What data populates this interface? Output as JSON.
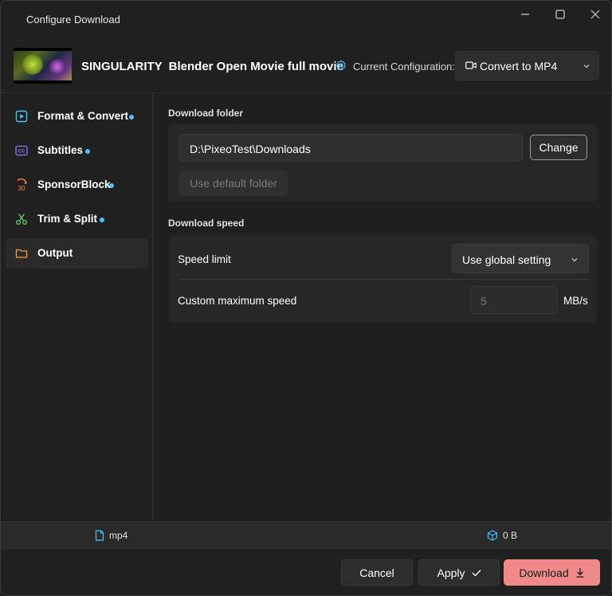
{
  "window": {
    "title": "Configure Download",
    "controls": [
      "minimize-icon",
      "maximize-icon",
      "close-icon"
    ]
  },
  "header": {
    "video_title_part1": "SINGULARITY",
    "video_title_part2": "Blender Open Movie full movie",
    "config_label": "Current Configuration:",
    "config_value": "Convert to MP4",
    "config_icon": "video-icon",
    "accent": "#4cc2ff"
  },
  "sidebar": {
    "items": [
      {
        "label": "Format & Convert",
        "icon": "format-icon",
        "has_dot": true,
        "icon_color": "#4cc2ff"
      },
      {
        "label": "Subtitles",
        "icon": "subtitles-icon",
        "has_dot": true,
        "icon_color": "#8a7bff"
      },
      {
        "label": "SponsorBlock",
        "icon": "sponsorblock-icon",
        "has_dot": true,
        "icon_color": "#ff8a4c"
      },
      {
        "label": "Trim & Split",
        "icon": "scissors-icon",
        "has_dot": true,
        "icon_color": "#6ad06a"
      },
      {
        "label": "Output",
        "icon": "folder-icon",
        "has_dot": false,
        "icon_color": "#ff9a3c",
        "active": true
      }
    ]
  },
  "main": {
    "download_folder": {
      "section_label": "Download folder",
      "path_value": "D:\\PixeoTest\\Downloads",
      "change_label": "Change",
      "default_label": "Use default folder"
    },
    "download_speed": {
      "section_label": "Download speed",
      "speed_limit_label": "Speed limit",
      "speed_limit_value": "Use global setting",
      "custom_label": "Custom maximum speed",
      "custom_value": "5",
      "unit": "MB/s"
    }
  },
  "status": {
    "format": "mp4",
    "size": "0 B"
  },
  "footer": {
    "cancel_label": "Cancel",
    "apply_label": "Apply",
    "download_label": "Download",
    "download_color": "#f08a8a"
  }
}
